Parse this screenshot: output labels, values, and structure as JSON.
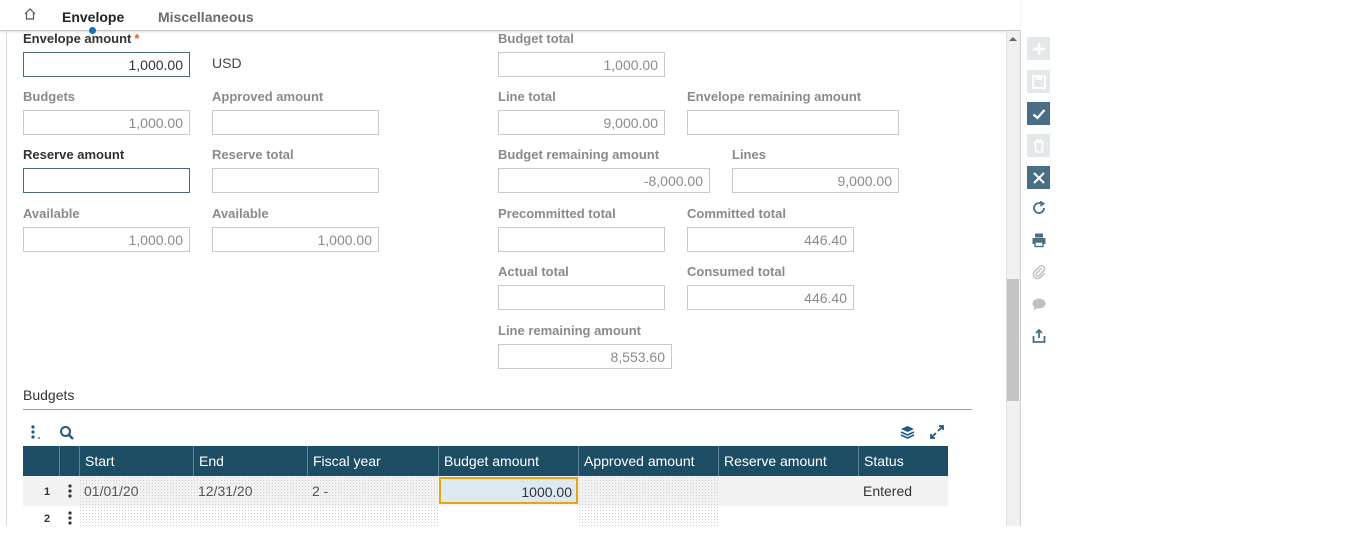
{
  "tabs": [
    {
      "label": "Envelope",
      "active": true
    },
    {
      "label": "Miscellaneous",
      "active": false
    }
  ],
  "form": {
    "envelope_amount": {
      "label": "Envelope amount",
      "value": "1,000.00",
      "currency": "USD"
    },
    "budgets": {
      "label": "Budgets",
      "value": "1,000.00"
    },
    "approved_amount": {
      "label": "Approved amount",
      "value": ""
    },
    "reserve_amount": {
      "label": "Reserve amount",
      "value": ""
    },
    "reserve_total": {
      "label": "Reserve total",
      "value": ""
    },
    "available_1": {
      "label": "Available",
      "value": "1,000.00"
    },
    "available_2": {
      "label": "Available",
      "value": "1,000.00"
    },
    "budget_total": {
      "label": "Budget total",
      "value": "1,000.00"
    },
    "line_total": {
      "label": "Line total",
      "value": "9,000.00"
    },
    "envelope_remaining_amount": {
      "label": "Envelope remaining amount",
      "value": ""
    },
    "budget_remaining_amount": {
      "label": "Budget remaining amount",
      "value": "-8,000.00"
    },
    "lines": {
      "label": "Lines",
      "value": "9,000.00"
    },
    "precommitted_total": {
      "label": "Precommitted total",
      "value": ""
    },
    "committed_total": {
      "label": "Committed total",
      "value": "446.40"
    },
    "actual_total": {
      "label": "Actual total",
      "value": ""
    },
    "consumed_total": {
      "label": "Consumed total",
      "value": "446.40"
    },
    "line_remaining_amount": {
      "label": "Line remaining amount",
      "value": "8,553.60"
    }
  },
  "budgets_section": {
    "title": "Budgets",
    "columns": [
      "Start",
      "End",
      "Fiscal year",
      "Budget amount",
      "Approved amount",
      "Reserve amount",
      "Status"
    ],
    "rows": [
      {
        "num": "1",
        "start": "01/01/20",
        "end": "12/31/20",
        "fiscal_year": "2 -",
        "budget_amount": "1000.00",
        "approved_amount": "",
        "reserve_amount": "",
        "status": "Entered"
      },
      {
        "num": "2",
        "start": "",
        "end": "",
        "fiscal_year": "",
        "budget_amount": "",
        "approved_amount": "",
        "reserve_amount": "",
        "status": ""
      }
    ]
  },
  "toolbar_icons": [
    "plus-icon",
    "save-icon",
    "check-icon",
    "trash-icon",
    "close-icon",
    "refresh-icon",
    "print-icon",
    "paperclip-icon",
    "comment-icon",
    "share-icon"
  ],
  "colors": {
    "accent": "#1d4d64",
    "required": "#e0632b",
    "selected_cell": "#e8a317",
    "toolbar_dark": "#4a6e84"
  }
}
